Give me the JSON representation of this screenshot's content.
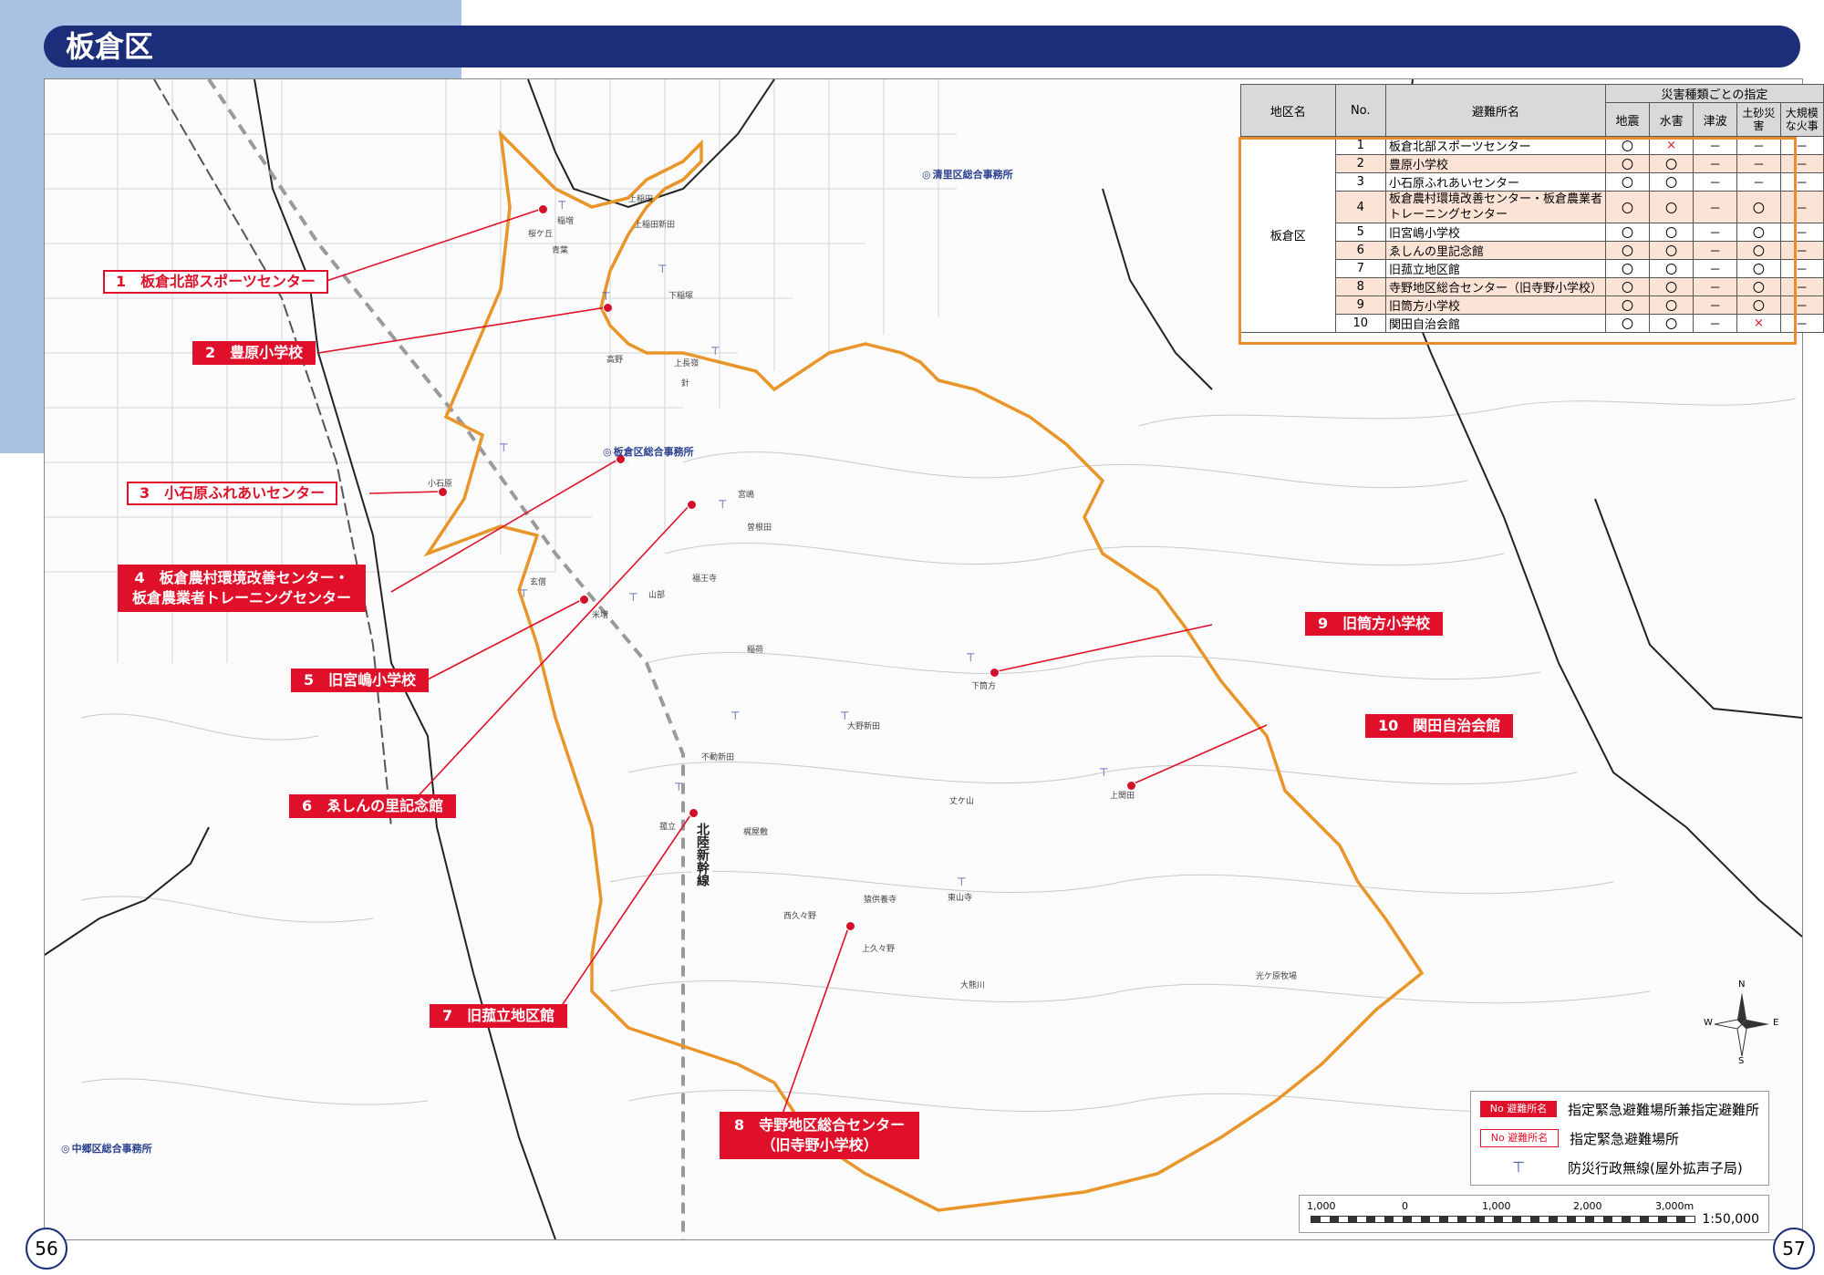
{
  "page": {
    "title": "板倉区",
    "left_page_number": "56",
    "right_page_number": "57"
  },
  "table": {
    "col_district": "地区名",
    "col_no": "No.",
    "col_name": "避難所名",
    "col_group": "災害種類ごとの指定",
    "col_types": [
      "地震",
      "水害",
      "津波",
      "土砂災害",
      "大規模な火事"
    ],
    "district": "板倉区",
    "rows": [
      {
        "no": "1",
        "name": "板倉北部スポーツセンター",
        "marks": [
          "〇",
          "×",
          "－",
          "－",
          "－"
        ]
      },
      {
        "no": "2",
        "name": "豊原小学校",
        "marks": [
          "〇",
          "〇",
          "－",
          "－",
          "－"
        ]
      },
      {
        "no": "3",
        "name": "小石原ふれあいセンター",
        "marks": [
          "〇",
          "〇",
          "－",
          "－",
          "－"
        ]
      },
      {
        "no": "4",
        "name": "板倉農村環境改善センター・板倉農業者トレーニングセンター",
        "marks": [
          "〇",
          "〇",
          "－",
          "〇",
          "－"
        ]
      },
      {
        "no": "5",
        "name": "旧宮嶋小学校",
        "marks": [
          "〇",
          "〇",
          "－",
          "〇",
          "－"
        ]
      },
      {
        "no": "6",
        "name": "ゑしんの里記念館",
        "marks": [
          "〇",
          "〇",
          "－",
          "〇",
          "－"
        ]
      },
      {
        "no": "7",
        "name": "旧菰立地区館",
        "marks": [
          "〇",
          "〇",
          "－",
          "〇",
          "－"
        ]
      },
      {
        "no": "8",
        "name": "寺野地区総合センター（旧寺野小学校）",
        "marks": [
          "〇",
          "〇",
          "－",
          "〇",
          "－"
        ]
      },
      {
        "no": "9",
        "name": "旧筒方小学校",
        "marks": [
          "〇",
          "〇",
          "－",
          "〇",
          "－"
        ]
      },
      {
        "no": "10",
        "name": "関田自治会館",
        "marks": [
          "〇",
          "〇",
          "－",
          "×",
          "－"
        ]
      }
    ]
  },
  "labels": {
    "l1": "1　板倉北部スポーツセンター",
    "l2": "2　豊原小学校",
    "l3": "3　小石原ふれあいセンター",
    "l4a": "4　板倉農村環境改善センター・",
    "l4b": "板倉農業者トレーニングセンター",
    "l5": "5　旧宮嶋小学校",
    "l6": "6　ゑしんの里記念館",
    "l7": "7　旧菰立地区館",
    "l8a": "8　寺野地区総合センター",
    "l8b": "（旧寺野小学校）",
    "l9": "9　旧筒方小学校",
    "l10": "10　関田自治会館"
  },
  "offices": {
    "itakura": "板倉区総合事務所",
    "kiyosato": "清里区総合事務所",
    "nakago": "中郷区総合事務所"
  },
  "railway": "北陸新幹線",
  "places": [
    {
      "id": "p1",
      "text": "稲増"
    },
    {
      "id": "p2",
      "text": "桜ケ丘"
    },
    {
      "id": "p3",
      "text": "青葉"
    },
    {
      "id": "p4",
      "text": "上稲田新田"
    },
    {
      "id": "p5",
      "text": "下稲塚"
    },
    {
      "id": "p6",
      "text": "高野"
    },
    {
      "id": "p7",
      "text": "上長嶺"
    },
    {
      "id": "p8",
      "text": "針"
    },
    {
      "id": "p9",
      "text": "小石原"
    },
    {
      "id": "p10",
      "text": "玄僧"
    },
    {
      "id": "p11",
      "text": "福王寺"
    },
    {
      "id": "p12",
      "text": "米増"
    },
    {
      "id": "p13",
      "text": "菰立"
    },
    {
      "id": "p14",
      "text": "梶屋敷"
    },
    {
      "id": "p15",
      "text": "大野新田"
    },
    {
      "id": "p16",
      "text": "下筒方"
    },
    {
      "id": "p17",
      "text": "上関田"
    },
    {
      "id": "p18",
      "text": "西久々野"
    },
    {
      "id": "p19",
      "text": "上久々野"
    },
    {
      "id": "p20",
      "text": "東山寺"
    },
    {
      "id": "p21",
      "text": "大熊川"
    },
    {
      "id": "p22",
      "text": "光ケ原牧場"
    },
    {
      "id": "p23",
      "text": "猿供養寺"
    },
    {
      "id": "p24",
      "text": "山部"
    },
    {
      "id": "p25",
      "text": "宮嶋"
    },
    {
      "id": "p26",
      "text": "曽根田"
    },
    {
      "id": "p27",
      "text": "不動新田"
    },
    {
      "id": "p28",
      "text": "稲荷"
    },
    {
      "id": "p29",
      "text": "丈ケ山"
    },
    {
      "id": "p30",
      "text": "上稲田"
    }
  ],
  "legend": {
    "swatch": "No 避難所名",
    "filled_desc": "指定緊急避難場所兼指定避難所",
    "outline_desc": "指定緊急避難場所",
    "siren_desc": "防災行政無線(屋外拡声子局)"
  },
  "scale": {
    "ticks": [
      "1,000",
      "0",
      "1,000",
      "2,000",
      "3,000m"
    ],
    "ratio": "1:50,000"
  },
  "compass": {
    "n": "N",
    "s": "S",
    "e": "E",
    "w": "W"
  }
}
